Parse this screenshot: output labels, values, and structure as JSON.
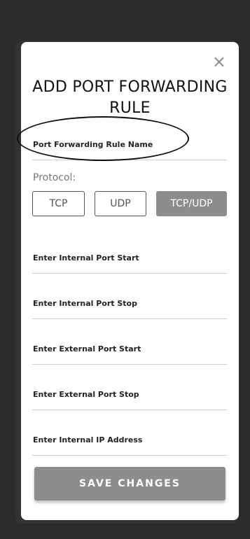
{
  "modal": {
    "title": "ADD PORT FORWARDING RULE",
    "close_icon": "×"
  },
  "form": {
    "rule_name_label": "Port Forwarding Rule Name",
    "protocol_label": "Protocol:",
    "protocol_options": [
      {
        "label": "TCP",
        "selected": false
      },
      {
        "label": "UDP",
        "selected": false
      },
      {
        "label": "TCP/UDP",
        "selected": true
      }
    ],
    "fields": [
      {
        "label": "Enter Internal Port Start"
      },
      {
        "label": "Enter Internal Port Stop"
      },
      {
        "label": "Enter External Port Start"
      },
      {
        "label": "Enter External Port Stop"
      },
      {
        "label": "Enter Internal IP Address"
      }
    ],
    "save_label": "SAVE CHANGES"
  },
  "colors": {
    "selected_button": "#8d8d8d",
    "save_button": "#8d8d8d"
  }
}
